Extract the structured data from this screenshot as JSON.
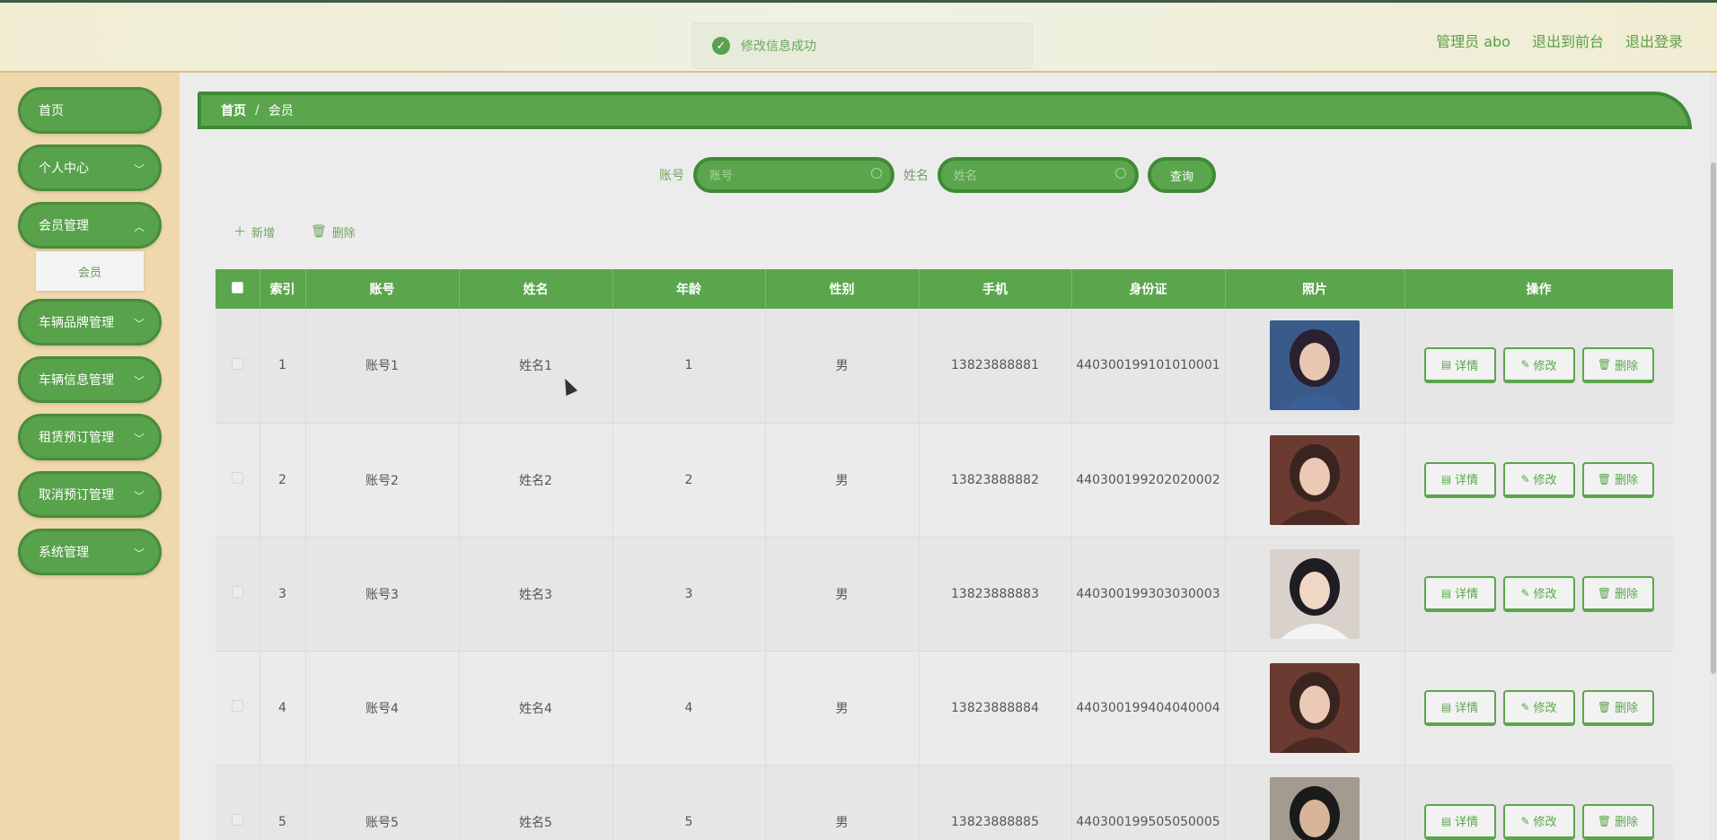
{
  "header": {
    "admin_label": "管理员 abo",
    "exit_frontend": "退出到前台",
    "logout": "退出登录"
  },
  "toast": {
    "message": "修改信息成功",
    "icon": "check-circle-icon"
  },
  "sidebar": {
    "items": [
      {
        "label": "首页"
      },
      {
        "label": "个人中心"
      },
      {
        "label": "会员管理"
      },
      {
        "label": "车辆品牌管理"
      },
      {
        "label": "车辆信息管理"
      },
      {
        "label": "租赁预订管理"
      },
      {
        "label": "取消预订管理"
      },
      {
        "label": "系统管理"
      }
    ],
    "submenu": {
      "label": "会员"
    }
  },
  "breadcrumb": {
    "home": "首页",
    "sep": "/",
    "current": "会员"
  },
  "search": {
    "account_label": "账号",
    "account_placeholder": "账号",
    "name_label": "姓名",
    "name_placeholder": "姓名",
    "query_button": "查询"
  },
  "actions": {
    "add": "新增",
    "delete": "删除"
  },
  "table": {
    "headers": [
      "索引",
      "账号",
      "姓名",
      "年龄",
      "性别",
      "手机",
      "身份证",
      "照片",
      "操作"
    ],
    "rows": [
      {
        "index": "1",
        "account": "账号1",
        "name": "姓名1",
        "age": "1",
        "gender": "男",
        "phone": "13823888881",
        "idcard": "440300199101010001"
      },
      {
        "index": "2",
        "account": "账号2",
        "name": "姓名2",
        "age": "2",
        "gender": "男",
        "phone": "13823888882",
        "idcard": "440300199202020002"
      },
      {
        "index": "3",
        "account": "账号3",
        "name": "姓名3",
        "age": "3",
        "gender": "男",
        "phone": "13823888883",
        "idcard": "440300199303030003"
      },
      {
        "index": "4",
        "account": "账号4",
        "name": "姓名4",
        "age": "4",
        "gender": "男",
        "phone": "13823888884",
        "idcard": "440300199404040004"
      },
      {
        "index": "5",
        "account": "账号5",
        "name": "姓名5",
        "age": "5",
        "gender": "男",
        "phone": "13823888885",
        "idcard": "440300199505050005"
      }
    ],
    "ops": {
      "detail": "详情",
      "edit": "修改",
      "delete": "删除"
    }
  },
  "colors": {
    "accent": "#5ba64d",
    "accent_dark": "#3f8a35",
    "sidebar_bg": "#efd8ac"
  }
}
